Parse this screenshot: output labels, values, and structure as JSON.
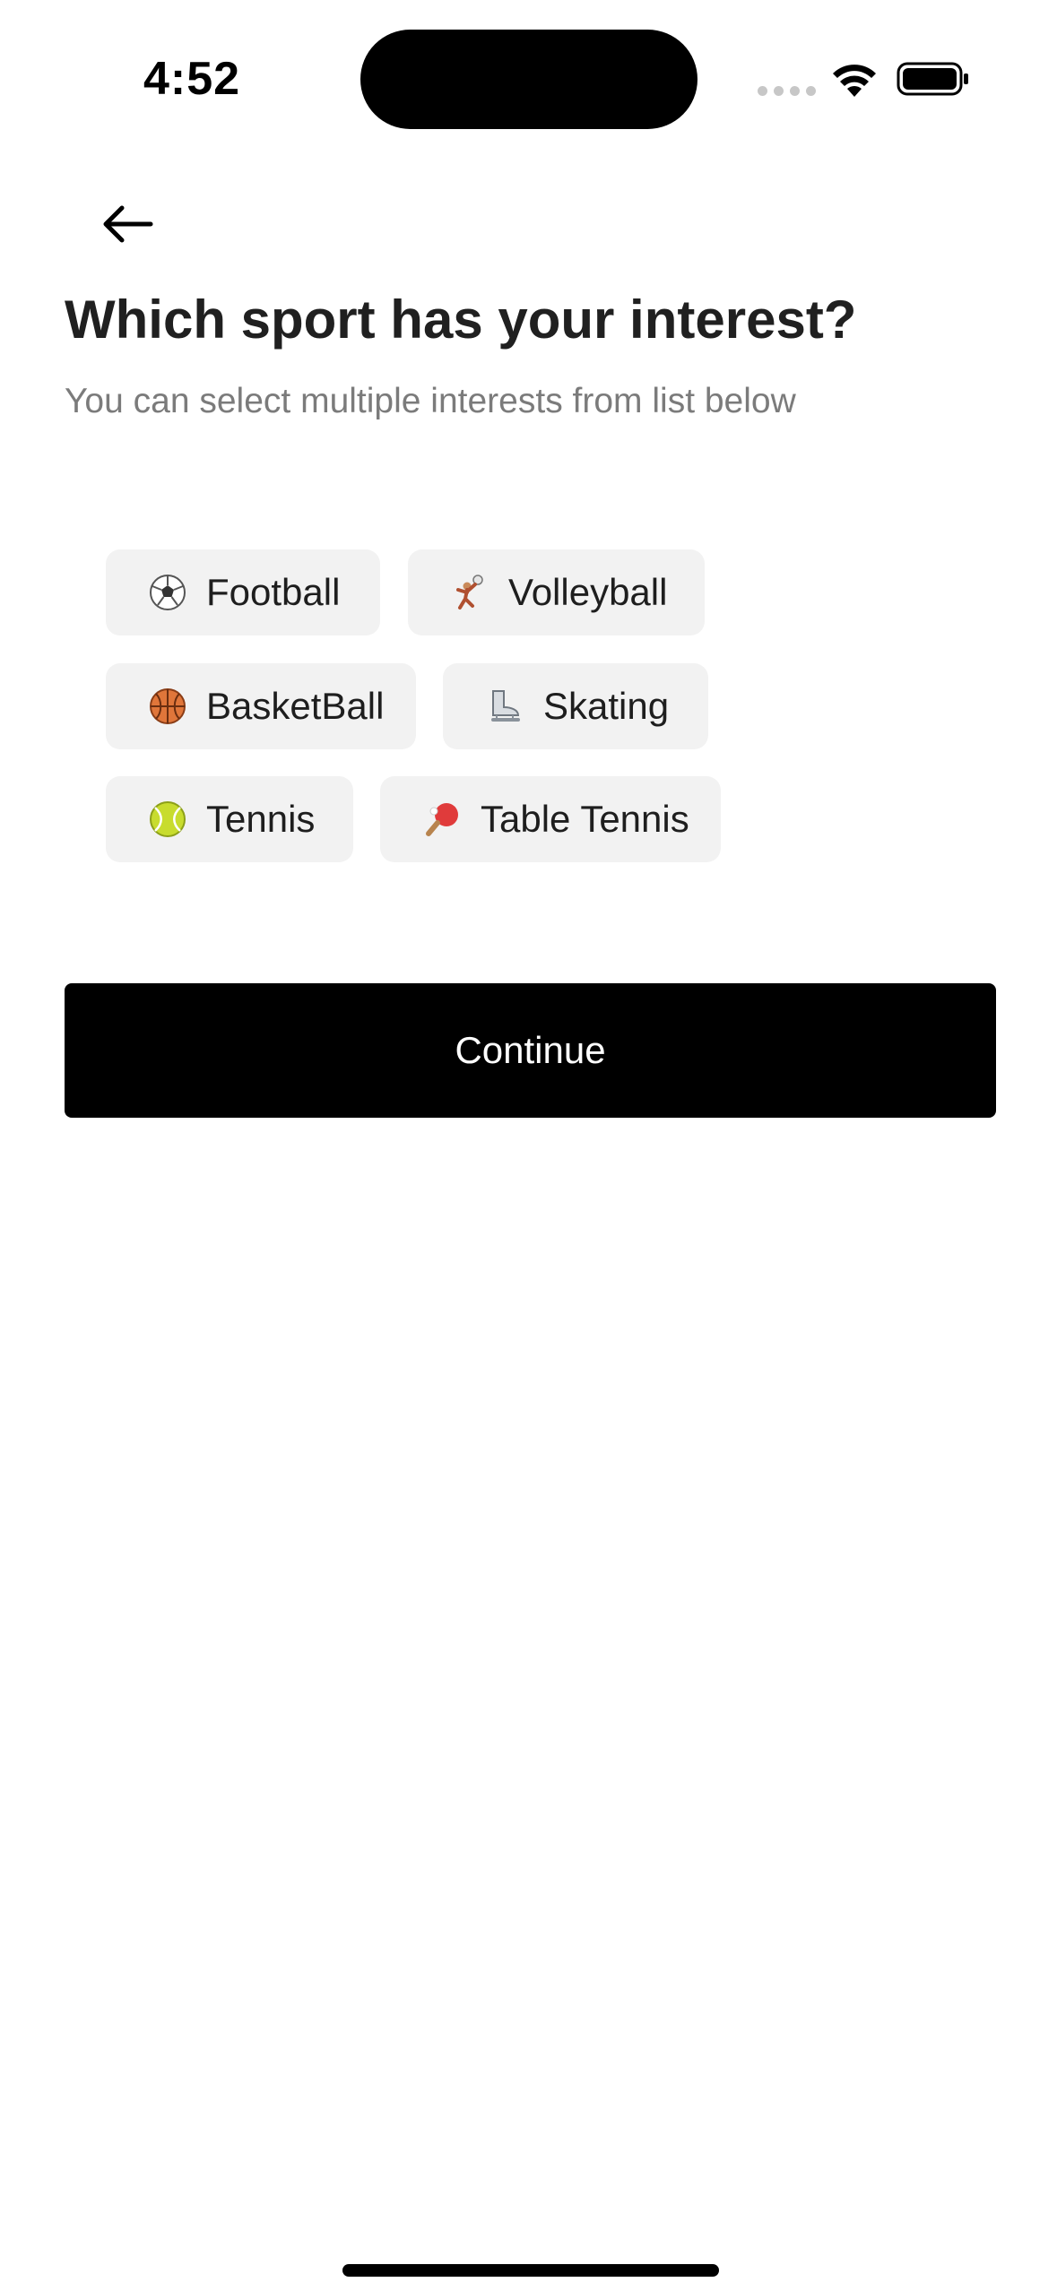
{
  "status_bar": {
    "time": "4:52"
  },
  "header": {
    "back_icon": "arrow-left-icon",
    "title": "Which sport has your interest?",
    "subtitle": "You can select multiple interests from list below"
  },
  "interests": [
    {
      "label": "Football",
      "icon": "soccer-ball-icon",
      "selected": false
    },
    {
      "label": "Volleyball",
      "icon": "volleyball-player-icon",
      "selected": false
    },
    {
      "label": "BasketBall",
      "icon": "basketball-icon",
      "selected": false
    },
    {
      "label": "Skating",
      "icon": "ice-skate-icon",
      "selected": false
    },
    {
      "label": "Tennis",
      "icon": "tennis-ball-icon",
      "selected": false
    },
    {
      "label": "Table Tennis",
      "icon": "ping-pong-paddle-icon",
      "selected": false
    }
  ],
  "actions": {
    "continue_label": "Continue"
  },
  "colors": {
    "chip_background": "#f2f2f2",
    "primary_button": "#000000",
    "subtitle_text": "#7b7b7b"
  }
}
